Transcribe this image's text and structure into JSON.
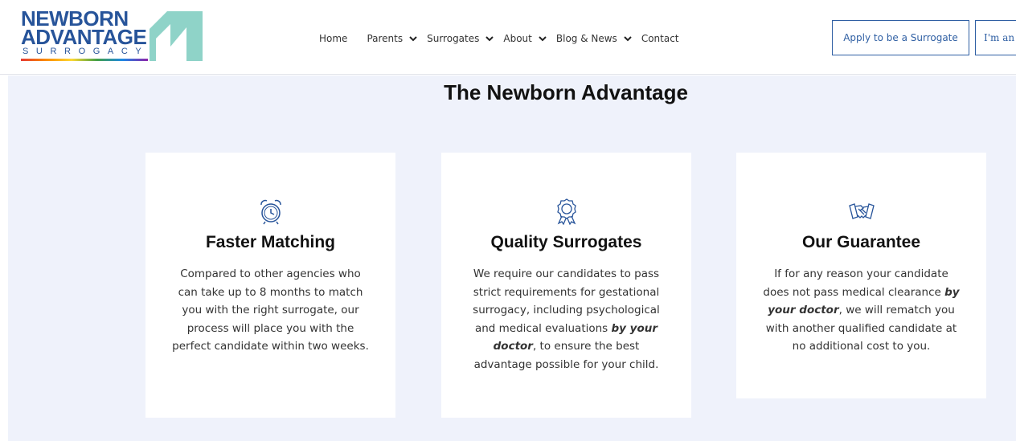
{
  "header": {
    "logo": {
      "line1": "NEWBORN",
      "line2": "ADVANTAGE",
      "sub": "SURROGACY",
      "mark_color": "#8fd3c8"
    },
    "nav": [
      {
        "label": "Home",
        "has_dropdown": false
      },
      {
        "label": "Parents",
        "has_dropdown": true
      },
      {
        "label": "Surrogates",
        "has_dropdown": true
      },
      {
        "label": "About",
        "has_dropdown": true
      },
      {
        "label": "Blog & News",
        "has_dropdown": true
      },
      {
        "label": "Contact",
        "has_dropdown": false
      }
    ],
    "buttons": {
      "apply": "Apply to be a Surrogate",
      "im": "I'm an"
    },
    "colors": {
      "brand": "#27549a",
      "accent": "#2f5fa3"
    }
  },
  "section": {
    "title": "The Newborn Advantage",
    "background": "#eff2fb",
    "cards": [
      {
        "icon": "alarm-clock-icon",
        "title": "Faster Matching",
        "body": "Compared to other agencies who can take up to 8 months to match you with the right surrogate, our process will place you with the perfect candidate within two weeks."
      },
      {
        "icon": "award-ribbon-icon",
        "title": "Quality Surrogates",
        "body_pre": "We require our candidates to pass strict requirements for gestational surrogacy, including psychological and medical evaluations ",
        "body_em": "by your doctor",
        "body_post": ", to ensure the best advantage possible for your child."
      },
      {
        "icon": "handshake-icon",
        "title": "Our Guarantee",
        "body_pre": "If for any reason your candidate does not pass medical clearance ",
        "body_em": "by your doctor",
        "body_post": ", we will rematch you with another qualified candidate at no additional cost to you."
      }
    ]
  }
}
